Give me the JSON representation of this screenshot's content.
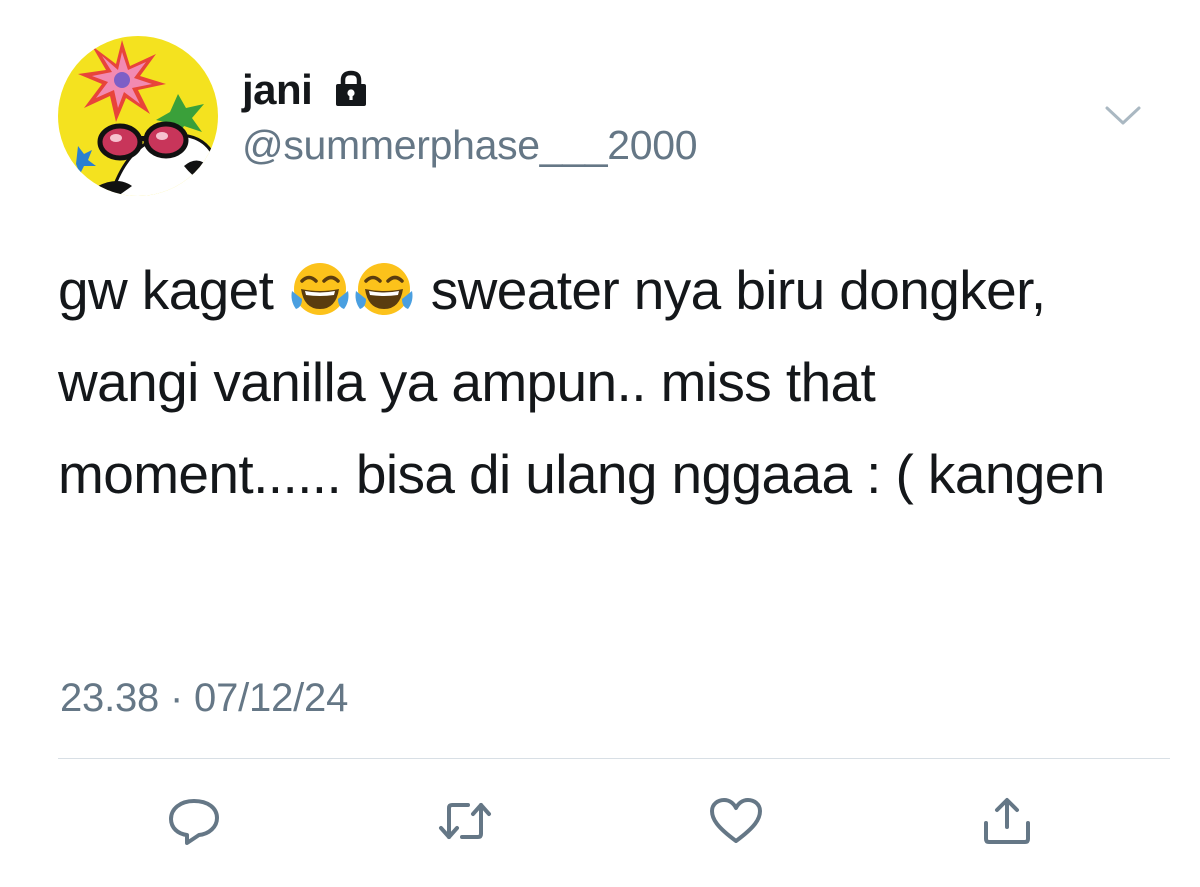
{
  "tweet": {
    "display_name": "jani",
    "handle": "@summerphase___2000",
    "text_parts": [
      "gw kaget ",
      " sweater nya biru dongker, wangi vanilla ya ampun.. miss that moment...... bisa di ulang nggaaa : ( kangen"
    ],
    "emojis": [
      "face-with-tears-of-joy",
      "face-with-tears-of-joy"
    ],
    "timestamp": "23.38 · 07/12/24",
    "locked": true
  },
  "actions": [
    "reply-icon",
    "retweet-icon",
    "like-icon",
    "share-icon"
  ],
  "colors": {
    "text": "#14171a",
    "secondary": "#657786",
    "divider": "#d8dfe5",
    "icon": "#657786"
  }
}
